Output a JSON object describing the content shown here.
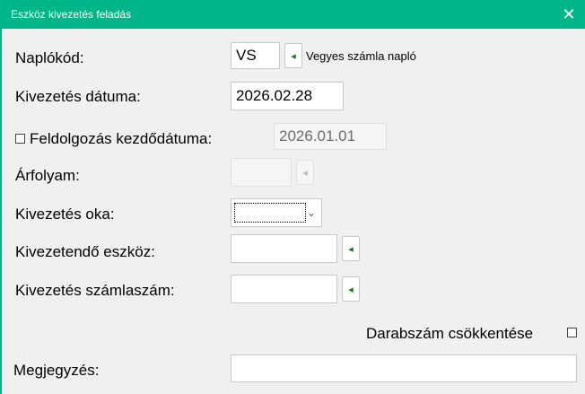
{
  "window": {
    "title": "Eszköz kivezetés feladás",
    "close_glyph": "✕"
  },
  "fields": {
    "naplo": {
      "label": "Naplókód:",
      "value": "VS",
      "description": "Vegyes számla napló"
    },
    "kivezetes_datum": {
      "label": "Kivezetés dátuma:",
      "value": "2026.02.28"
    },
    "feldolgozas": {
      "label": "Feldolgozás kezdődátuma:",
      "value": "2026.01.01",
      "checked": false
    },
    "arfolyam": {
      "label": "Árfolyam:",
      "value": ""
    },
    "kivezetes_oka": {
      "label": "Kivezetés oka:",
      "value": ""
    },
    "kivezetendo_eszkoz": {
      "label": "Kivezetendő eszköz:",
      "value": ""
    },
    "szamlaszam": {
      "label": "Kivezetés számlaszám:",
      "value": ""
    },
    "darabszam": {
      "label": "Darabszám csökkentése",
      "checked": false
    },
    "megjegyzes": {
      "label": "Megjegyzés:",
      "value": ""
    }
  },
  "icons": {
    "lookup": "arrow-left-icon",
    "dropdown": "chevron-down-icon"
  },
  "colors": {
    "titlebar": "#00b689",
    "lookup_arrow": "#1a7a1a"
  }
}
